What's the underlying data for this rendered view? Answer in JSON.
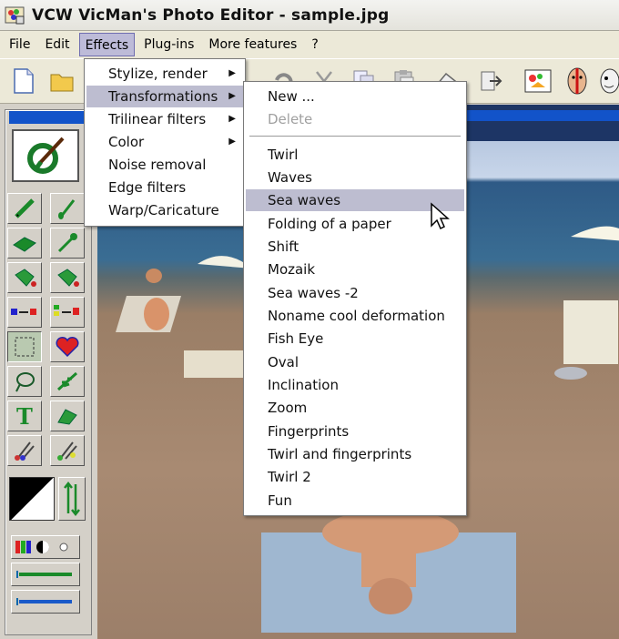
{
  "window": {
    "title": "VCW VicMan's Photo Editor - sample.jpg"
  },
  "menubar": {
    "items": [
      "File",
      "Edit",
      "Effects",
      "Plug-ins",
      "More features",
      "?"
    ]
  },
  "effects_menu": {
    "items": [
      {
        "label": "Stylize, render",
        "submenu": true
      },
      {
        "label": "Transformations",
        "submenu": true,
        "highlighted": true
      },
      {
        "label": "Trilinear filters",
        "submenu": true
      },
      {
        "label": "Color",
        "submenu": true
      },
      {
        "label": "Noise removal",
        "submenu": false
      },
      {
        "label": "Edge filters",
        "submenu": false
      },
      {
        "label": "Warp/Caricature",
        "submenu": false
      }
    ]
  },
  "transformations_menu": {
    "top_items": [
      {
        "label": "New ...",
        "disabled": false
      },
      {
        "label": "Delete",
        "disabled": true
      }
    ],
    "items": [
      "Twirl",
      "Waves",
      "Sea waves",
      "Folding of a paper",
      "Shift",
      "Mozaik",
      "Sea waves -2",
      "Noname cool deformation",
      "Fish Eye",
      "Oval",
      "Inclination",
      "Zoom",
      "Fingerprints",
      "Twirl and fingerprints",
      "Twirl 2",
      "Fun"
    ],
    "highlighted": "Sea waves"
  },
  "toolbar": {
    "icons": [
      "new-file-icon",
      "open-folder-icon",
      "undo-icon",
      "cut-icon",
      "copy-icon",
      "paste-icon",
      "eraser-icon",
      "export-icon",
      "image-paint-icon",
      "face-icon",
      "caricature-icon"
    ]
  },
  "tools": {
    "names": [
      "pencil-tool",
      "brush-tool",
      "eraser-tool",
      "dropper-tool",
      "fill-tool",
      "spray-fill-tool",
      "replace-color-tool",
      "replace-color-2-tool",
      "select-rect-tool",
      "heart-stamp-tool",
      "lasso-tool",
      "plant-stamp-tool",
      "text-tool",
      "gradient-fill-tool",
      "brushes-tool",
      "brushes-2-tool"
    ]
  },
  "colors": {
    "menu_highlight": "#bdbdd0",
    "accent_blue": "#1253c9"
  }
}
